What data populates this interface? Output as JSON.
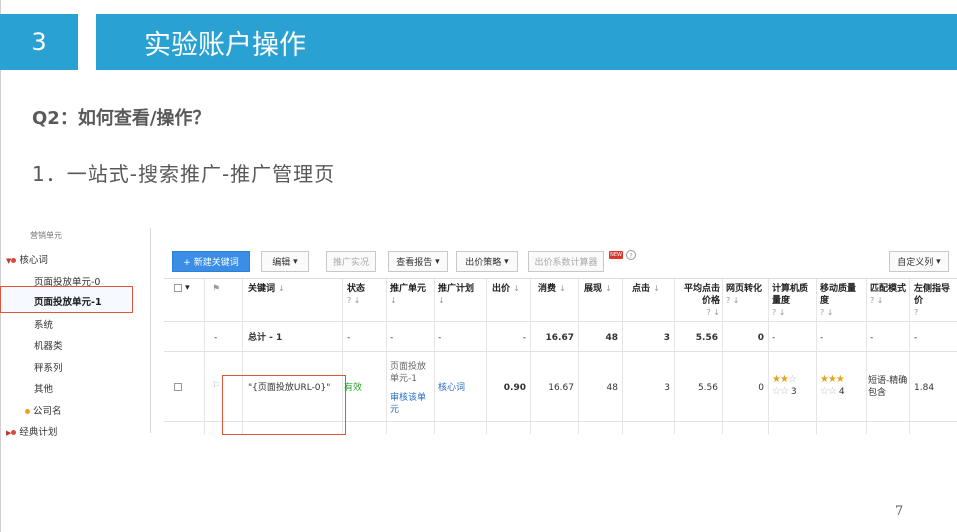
{
  "header": {
    "number": "3",
    "title": "实验账户操作"
  },
  "question": "Q2：如何查看/操作？",
  "step": "1．一站式-搜索推广-推广管理页",
  "page_number": "7",
  "tree": {
    "items": [
      {
        "label": "营销单元",
        "indent": 1
      },
      {
        "label": "核心词",
        "indent": 0
      },
      {
        "label": "页面投放单元-0",
        "indent": 1
      },
      {
        "label": "页面投放单元-1",
        "indent": 1
      },
      {
        "label": "系统",
        "indent": 1
      },
      {
        "label": "机器类",
        "indent": 1
      },
      {
        "label": "秤系列",
        "indent": 1
      },
      {
        "label": "其他",
        "indent": 1
      },
      {
        "label": "公司名",
        "indent": 1
      },
      {
        "label": "经典计划",
        "indent": 0
      }
    ]
  },
  "toolbar": {
    "new_keyword": "+ 新建关键词",
    "edit": "编辑",
    "promo_status": "推广实况",
    "view_report": "查看报告",
    "bid_strategy": "出价策略",
    "bid_calc": "出价系数计算器",
    "new_badge": "NEW",
    "custom_columns": "自定义列"
  },
  "table": {
    "headers": [
      "关键词",
      "状态",
      "推广单元",
      "推广计划",
      "出价",
      "消费",
      "展现",
      "点击",
      "平均点击价格",
      "网页转化",
      "计算机质量度",
      "移动质量度",
      "匹配模式",
      "左侧指导价"
    ],
    "total_row": {
      "keyword": "总计 - 1",
      "status": "-",
      "unit": "-",
      "plan": "-",
      "bid": "-",
      "cost": "16.67",
      "impressions": "48",
      "clicks": "3",
      "avg_cpc": "5.56",
      "conversions": "0",
      "pc_quality": "-",
      "mobile_quality": "-",
      "match": "-",
      "guide_price": "-"
    },
    "row": {
      "keyword": "\"{页面投放URL-0}\"",
      "status": "有效",
      "unit": "页面投放单元-1",
      "unit_action": "审核该单元",
      "plan": "核心词",
      "bid": "0.90",
      "cost": "16.67",
      "impressions": "48",
      "clicks": "3",
      "avg_cpc": "5.56",
      "conversions": "0",
      "pc_quality": "3",
      "mobile_quality": "4",
      "match": "短语-精确包含",
      "guide_price": "1.84"
    }
  },
  "colors": {
    "header_blue": "#2aa1d3",
    "highlight_red": "#e0553a",
    "button_blue": "#3a8ee6"
  }
}
